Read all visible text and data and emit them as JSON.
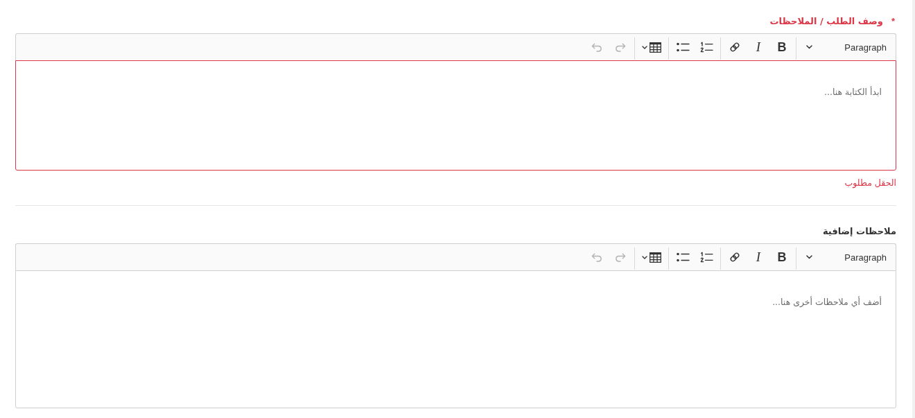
{
  "fields": [
    {
      "label": "وصف الطلب / الملاحظات",
      "required_mark": "*",
      "invalid": true,
      "toolbar": {
        "groups": [
          [
            {
              "kind": "heading",
              "label": "Paragraph",
              "disabled": false
            }
          ],
          [
            {
              "kind": "bold",
              "label": "B",
              "disabled": false
            },
            {
              "kind": "italic",
              "label": "I",
              "disabled": false
            },
            {
              "kind": "link",
              "disabled": false
            }
          ],
          [
            {
              "kind": "numbered-list",
              "disabled": false
            },
            {
              "kind": "bulleted-list",
              "disabled": false
            }
          ],
          [
            {
              "kind": "table",
              "disabled": false
            }
          ],
          [
            {
              "kind": "redo",
              "disabled": true
            },
            {
              "kind": "undo",
              "disabled": true
            }
          ]
        ]
      },
      "placeholder": "ابدأ الكتابة هنا...",
      "error": "الحقل مطلوب"
    },
    {
      "label": "ملاحظات إضافية",
      "invalid": false,
      "toolbar": {
        "groups": [
          [
            {
              "kind": "heading",
              "label": "Paragraph",
              "disabled": false
            }
          ],
          [
            {
              "kind": "bold",
              "label": "B",
              "disabled": false
            },
            {
              "kind": "italic",
              "label": "I",
              "disabled": false
            },
            {
              "kind": "link",
              "disabled": false
            }
          ],
          [
            {
              "kind": "numbered-list",
              "disabled": false
            },
            {
              "kind": "bulleted-list",
              "disabled": false
            }
          ],
          [
            {
              "kind": "table",
              "disabled": false
            }
          ],
          [
            {
              "kind": "redo",
              "disabled": true
            },
            {
              "kind": "undo",
              "disabled": true
            }
          ]
        ]
      },
      "placeholder": "أضف أي ملاحظات أخرى هنا..."
    }
  ]
}
